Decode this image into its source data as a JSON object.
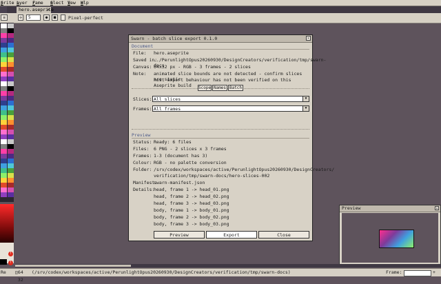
{
  "menubar": {
    "items": [
      {
        "mnemonic": "S",
        "rest": "prite"
      },
      {
        "mnemonic": "L",
        "rest": "ayer"
      },
      {
        "mnemonic": "F",
        "rest": "rame"
      },
      {
        "mnemonic": "S",
        "rest": "elect"
      },
      {
        "mnemonic": "V",
        "rest": "iew"
      },
      {
        "mnemonic": "H",
        "rest": "elp"
      }
    ]
  },
  "tab": {
    "label": "hero.aseprite",
    "close": "×"
  },
  "toolbar": {
    "zoom_value": "5",
    "pixel_perfect_label": "Pixel-perfect"
  },
  "dialog": {
    "title": "Swarn - batch slice export 0.1.0",
    "close": "×",
    "document": {
      "section": "Document",
      "file_label": "File:",
      "file_value": "hero.aseprite",
      "saved_label": "Saved in:",
      "saved_value": "../PerunlightOpus20260930/DesignCreators/verification/tmp/swarn-docs",
      "canvas_label": "Canvas:",
      "canvas_value": "64x32 px  -  RGB  -  3 frames  -  2 slices",
      "note_label": "Note:",
      "note_line1": "animated slice bounds are not detected - confirm slices are static",
      "note_line2": "host export behaviour has not been verified on this Aseprite build"
    },
    "scope_tabs": [
      "Scope",
      "Names",
      "Batch"
    ],
    "slices_label": "Slices:",
    "slices_value": "All slices",
    "frames_label": "Frames:",
    "frames_value": "All frames",
    "preview": {
      "section": "Preview",
      "status_label": "Status:",
      "status_value": "Ready: 6 files",
      "files_label": "Files:",
      "files_value": "6 PNG  -  2 slices x 3 frames",
      "frames_label": "Frames:",
      "frames_value": "1-3   (document has 3)",
      "colour_label": "Colour:",
      "colour_value": "RGB  -  no palette conversion",
      "folder_label": "Folder:",
      "folder_line1": "/srv/codex/workspaces/active/PerunlightOpus20260930/DesignCreators/",
      "folder_line2": "verification/tmp/swarn-docs/hero-slices-002",
      "manifest_label": "Manifest:",
      "manifest_value": "swarn-manifest.json",
      "details_label": "Details:",
      "details": [
        "head, frame 1  ->  head_01.png",
        "head, frame 2  ->  head_02.png",
        "head, frame 3  ->  head_03.png",
        "body, frame 1  ->  body_01.png",
        "body, frame 2  ->  body_02.png",
        "body, frame 3  ->  body_03.png"
      ]
    },
    "buttons": {
      "preview": "Preview",
      "export": "Export",
      "close": "Close"
    }
  },
  "preview_panel": {
    "title": "Preview",
    "close": "×"
  },
  "statusbar": {
    "left_text": "Re",
    "coords": "64 32",
    "path": "(/srv/codex/workspaces/active/PerunlightOpus20260930/DesignCreators/verification/tmp/swarn-docs)",
    "frame_label": "Frame:"
  },
  "colors": {
    "palette": [
      "#ffffff",
      "#c8c8c8",
      "#7f7f7f",
      "#000000",
      "#ff3fa7",
      "#b3287e",
      "#7a3a9c",
      "#4c2a82",
      "#2e3f8f",
      "#2c6fd1",
      "#3fa0e0",
      "#4fc7d8",
      "#3fbf8a",
      "#49a03b",
      "#8df06a",
      "#d8e04a",
      "#ffd23a",
      "#ff8f2e",
      "#e04a2a",
      "#a52a2a",
      "#ff6fcf",
      "#d44fb0",
      "#8f3fbf",
      "#5a2fa0"
    ]
  }
}
